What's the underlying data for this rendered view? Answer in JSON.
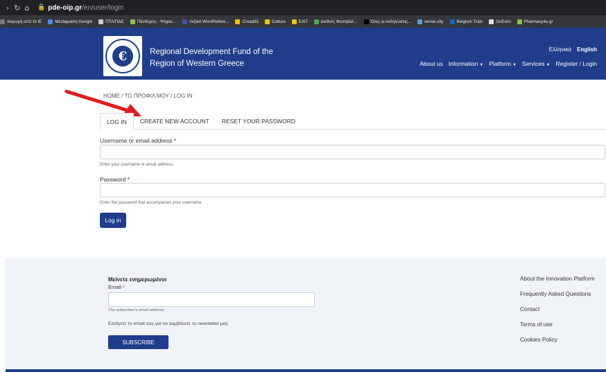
{
  "browser": {
    "url_host": "pde-oip.gr",
    "url_path": "/en/user/login",
    "bookmarks": [
      {
        "label": "παγωγή από το IE",
        "color": "#7a7a7a"
      },
      {
        "label": "Μετάφραση Google",
        "color": "#4a8af4"
      },
      {
        "label": "ΠΤΑ/ΠΔΕ",
        "color": "#cccccc"
      },
      {
        "label": "Πάνδημος - Ψηφια...",
        "color": "#8bc34a"
      },
      {
        "label": "Λεξικό WordRefere...",
        "color": "#3f51b5"
      },
      {
        "label": "Creadit3",
        "color": "#f4c20d"
      },
      {
        "label": "Culture",
        "color": "#f4c20d"
      },
      {
        "label": "ΕΑΠ",
        "color": "#f4c20d"
      },
      {
        "label": "Διεθνές Φεστιβάλ...",
        "color": "#4caf50"
      },
      {
        "label": "Όλες οι εκδηλώσεις...",
        "color": "#000000"
      },
      {
        "label": "sense.city",
        "color": "#5c9bd5"
      },
      {
        "label": "Belgium Train",
        "color": "#1565c0"
      },
      {
        "label": "GoEuro",
        "color": "#e0e0e0"
      },
      {
        "label": "Pharmacy4u.gr",
        "color": "#8bc34a"
      }
    ]
  },
  "header": {
    "logo_letter": "€",
    "title_line1": "Regional Development Fund of the",
    "title_line2": "Region of Western Greece",
    "lang_el": "Ελληνικά",
    "lang_en": "English",
    "nav": [
      {
        "label": "About us",
        "dropdown": false
      },
      {
        "label": "Information",
        "dropdown": true
      },
      {
        "label": "Platform",
        "dropdown": true
      },
      {
        "label": "Services",
        "dropdown": true
      },
      {
        "label": "Register / Login",
        "dropdown": false
      }
    ],
    "caret": "▼"
  },
  "breadcrumb": "HOME / ΤΟ ΠΡΟΦΙΛ ΜΟΥ / LOG IN",
  "tabs": [
    "LOG IN",
    "CREATE NEW ACCOUNT",
    "RESET YOUR PASSWORD"
  ],
  "form": {
    "username_label": "Username or email address",
    "username_hint": "Enter your username or email address.",
    "password_label": "Password",
    "password_hint": "Enter the password that accompanies your username.",
    "required_mark": "*",
    "login_button": "Log in"
  },
  "footer": {
    "title": "Μείνετε ενημερωμένοι",
    "email_label": "Email",
    "email_hint": "The subscriber's email address.",
    "note": "Εισάγετε το email σας για να λαμβάνετε το newsletter μας",
    "subscribe_button": "SUBSCRIBE",
    "links": [
      "About the Innovation Platform",
      "Frequently Asked Questions",
      "Contact",
      "Terms of use",
      "Cookies Policy"
    ]
  },
  "colors": {
    "brand_blue": "#1f3d8a",
    "arrow_red": "#e41b1b"
  }
}
